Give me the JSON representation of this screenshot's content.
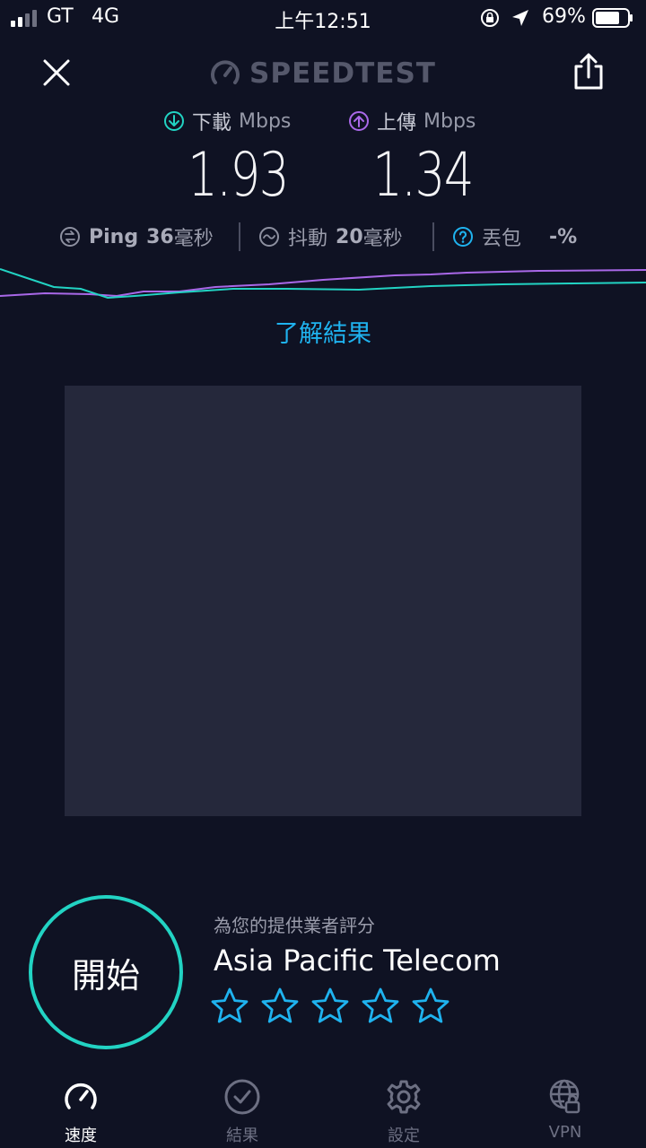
{
  "status_bar": {
    "carrier": "GT",
    "network": "4G",
    "time": "上午12:51",
    "battery": "69%"
  },
  "header": {
    "logo": "SPEEDTEST",
    "icons": [
      "close-icon",
      "speedometer-icon",
      "share-icon"
    ]
  },
  "results": {
    "download": {
      "label": "下載",
      "unit": "Mbps",
      "value": "1.93",
      "color": "#22d3c3"
    },
    "upload": {
      "label": "上傳",
      "unit": "Mbps",
      "value": "1.34",
      "color": "#a968e8"
    },
    "ping": {
      "label": "Ping",
      "value": "36",
      "unit": "毫秒"
    },
    "jitter": {
      "label": "抖動",
      "value": "20",
      "unit": "毫秒"
    },
    "packet_loss": {
      "label": "丟包",
      "value": "-%"
    }
  },
  "learn_more": "了解結果",
  "rating": {
    "prompt": "為您的提供業者評分",
    "provider": "Asia Pacific Telecom",
    "stars": 0,
    "max_stars": 5
  },
  "start_button": "開始",
  "tabs": [
    {
      "label": "速度",
      "icon": "speedometer-icon",
      "active": true
    },
    {
      "label": "結果",
      "icon": "check-circle-icon",
      "active": false
    },
    {
      "label": "設定",
      "icon": "gear-icon",
      "active": false
    },
    {
      "label": "VPN",
      "icon": "vpn-globe-lock-icon",
      "active": false
    }
  ],
  "colors": {
    "background": "#0f1223",
    "accent": "#1fb3ef",
    "download": "#22d3c3",
    "upload": "#a968e8"
  }
}
